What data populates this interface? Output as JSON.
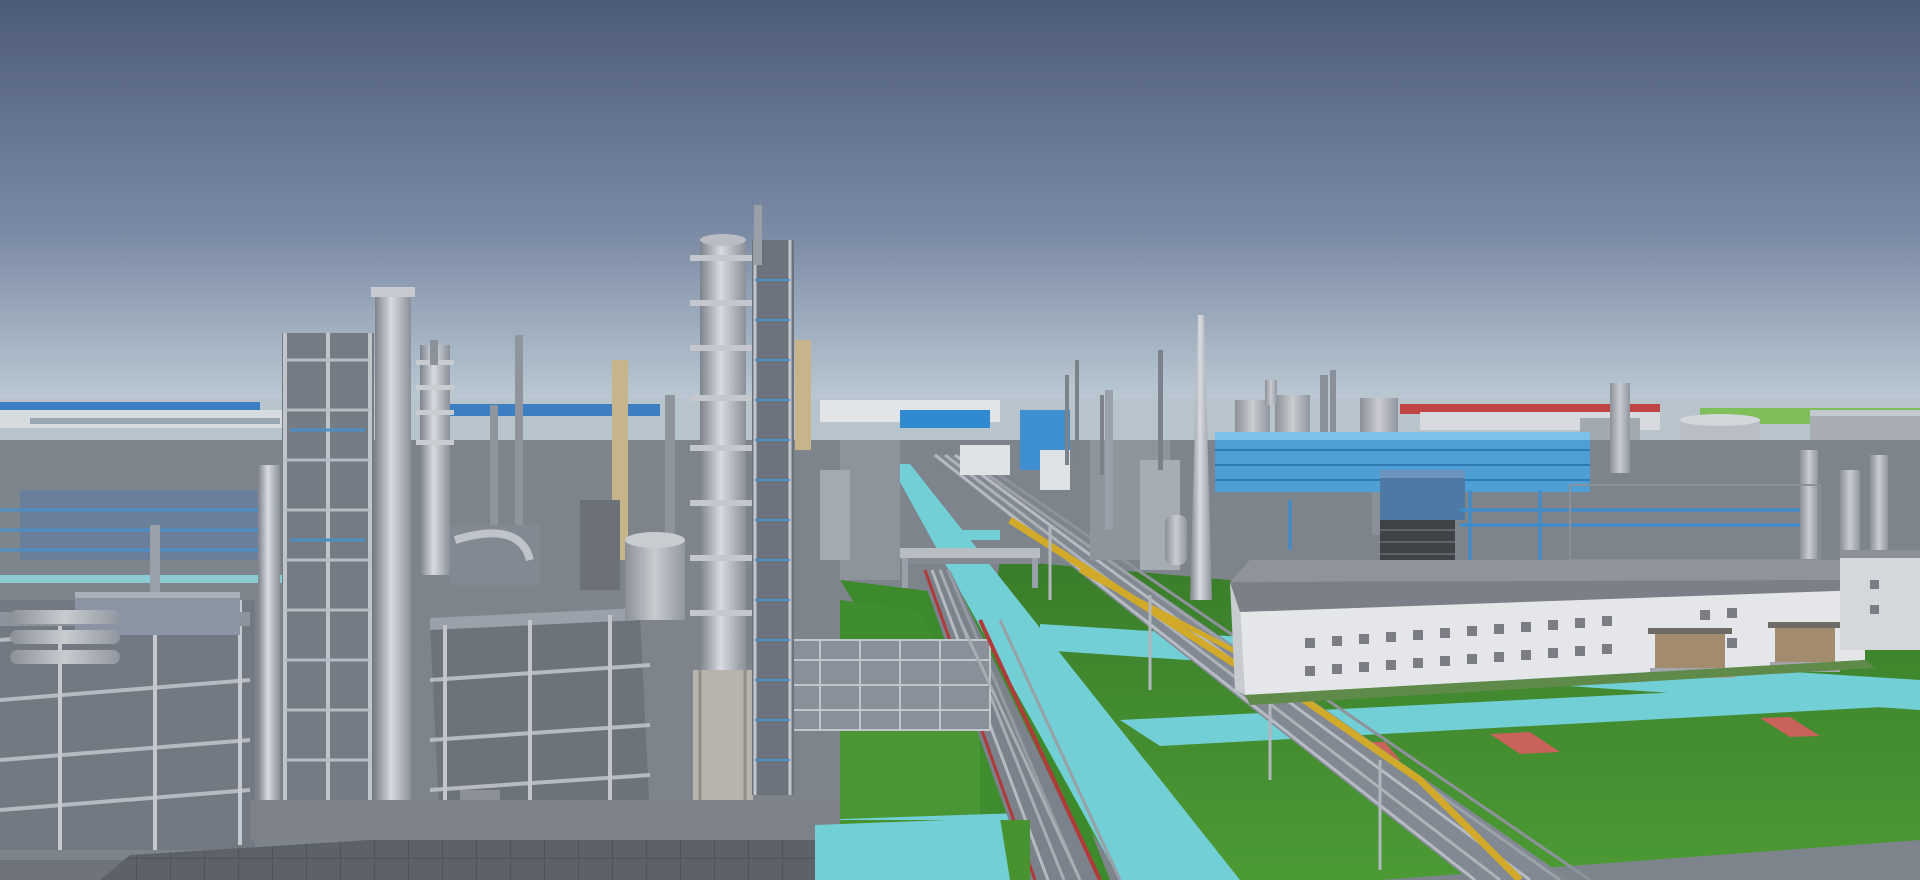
{
  "scene": {
    "kind": "3d-refinery-digital-twin",
    "colors": {
      "sky_top": "#4d5b7a",
      "sky_mid": "#7b8aa4",
      "sky_horizon": "#c2d0d8",
      "grass": "#3f8a2e",
      "walkway": "#73cfd6",
      "steel": "#9aa0aa",
      "steel_dark": "#6d737d",
      "building_wall": "#e4e6e9",
      "building_roof": "#868b93",
      "blue_structure": "#3e8fcf",
      "yellow_pipe": "#d1aa2a",
      "red_pipe": "#b03a3a",
      "concrete": "#8a8e94",
      "paving": "#5d6168"
    }
  }
}
